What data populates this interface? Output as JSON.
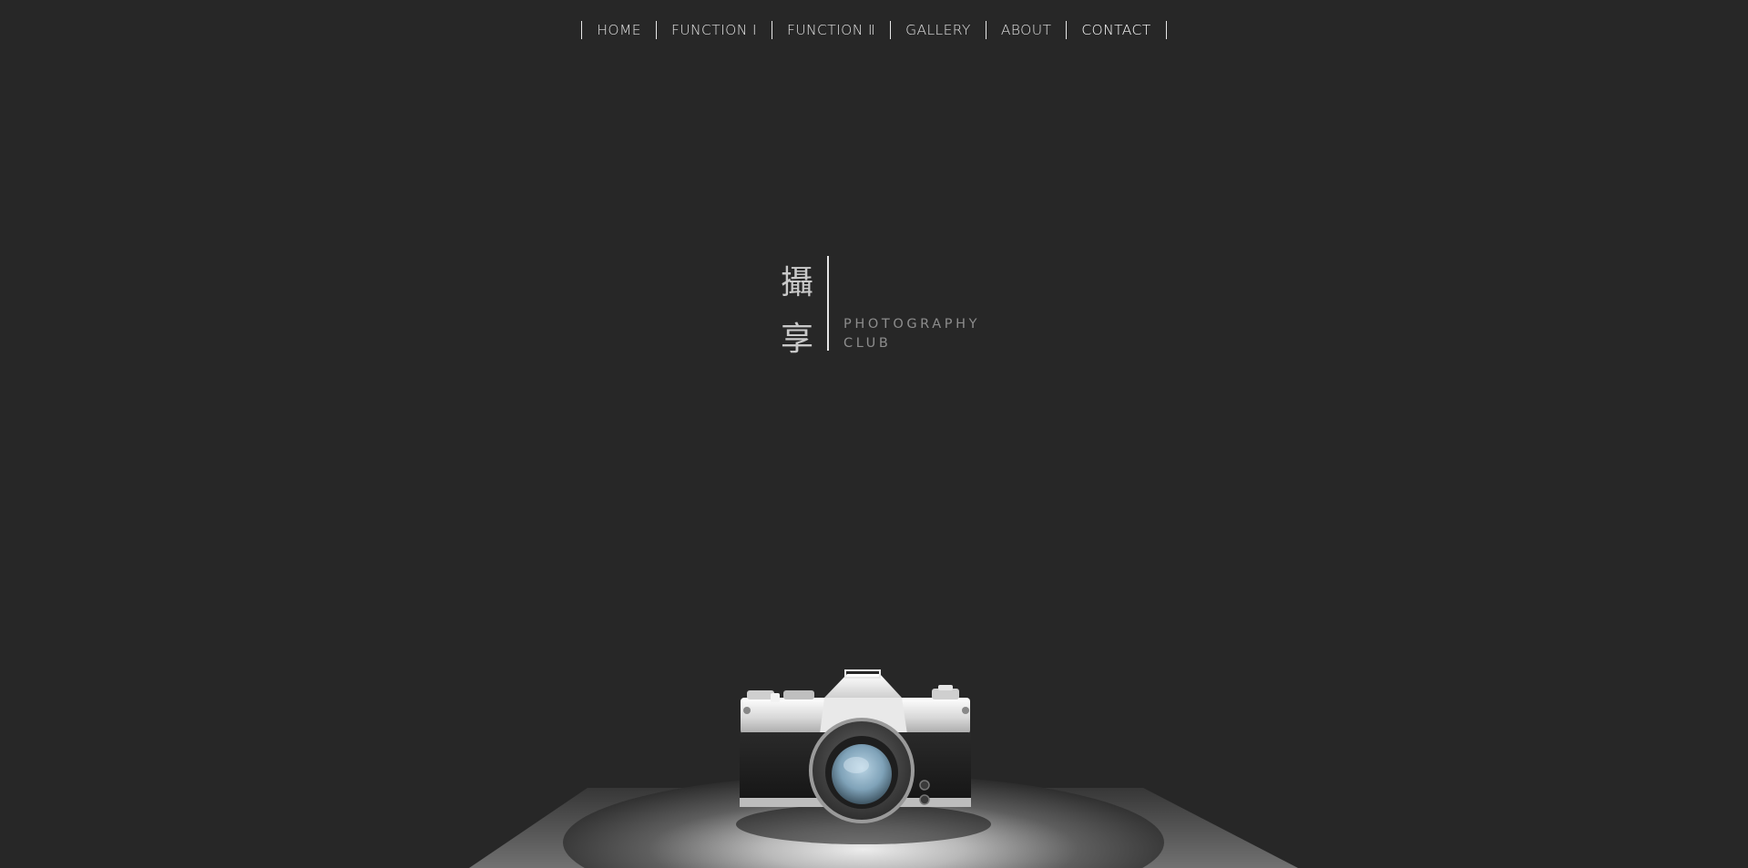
{
  "nav": {
    "items": [
      {
        "label": "HOME"
      },
      {
        "label": "FUNCTION Ⅰ"
      },
      {
        "label": "FUNCTION Ⅱ"
      },
      {
        "label": "GALLERY"
      },
      {
        "label": "ABOUT"
      },
      {
        "label": "CONTACT"
      }
    ]
  },
  "logo": {
    "chinese_line_1": "攝",
    "chinese_line_2": "享",
    "english_line_1": "PHOTOGRAPHY",
    "english_line_2": "CLUB"
  },
  "hero": {
    "image": "vintage-film-camera-icon"
  },
  "colors": {
    "background": "#272727",
    "nav_text": "#e0e0e0",
    "divider": "#e6e6e6",
    "subtitle": "#8d8d8d"
  }
}
